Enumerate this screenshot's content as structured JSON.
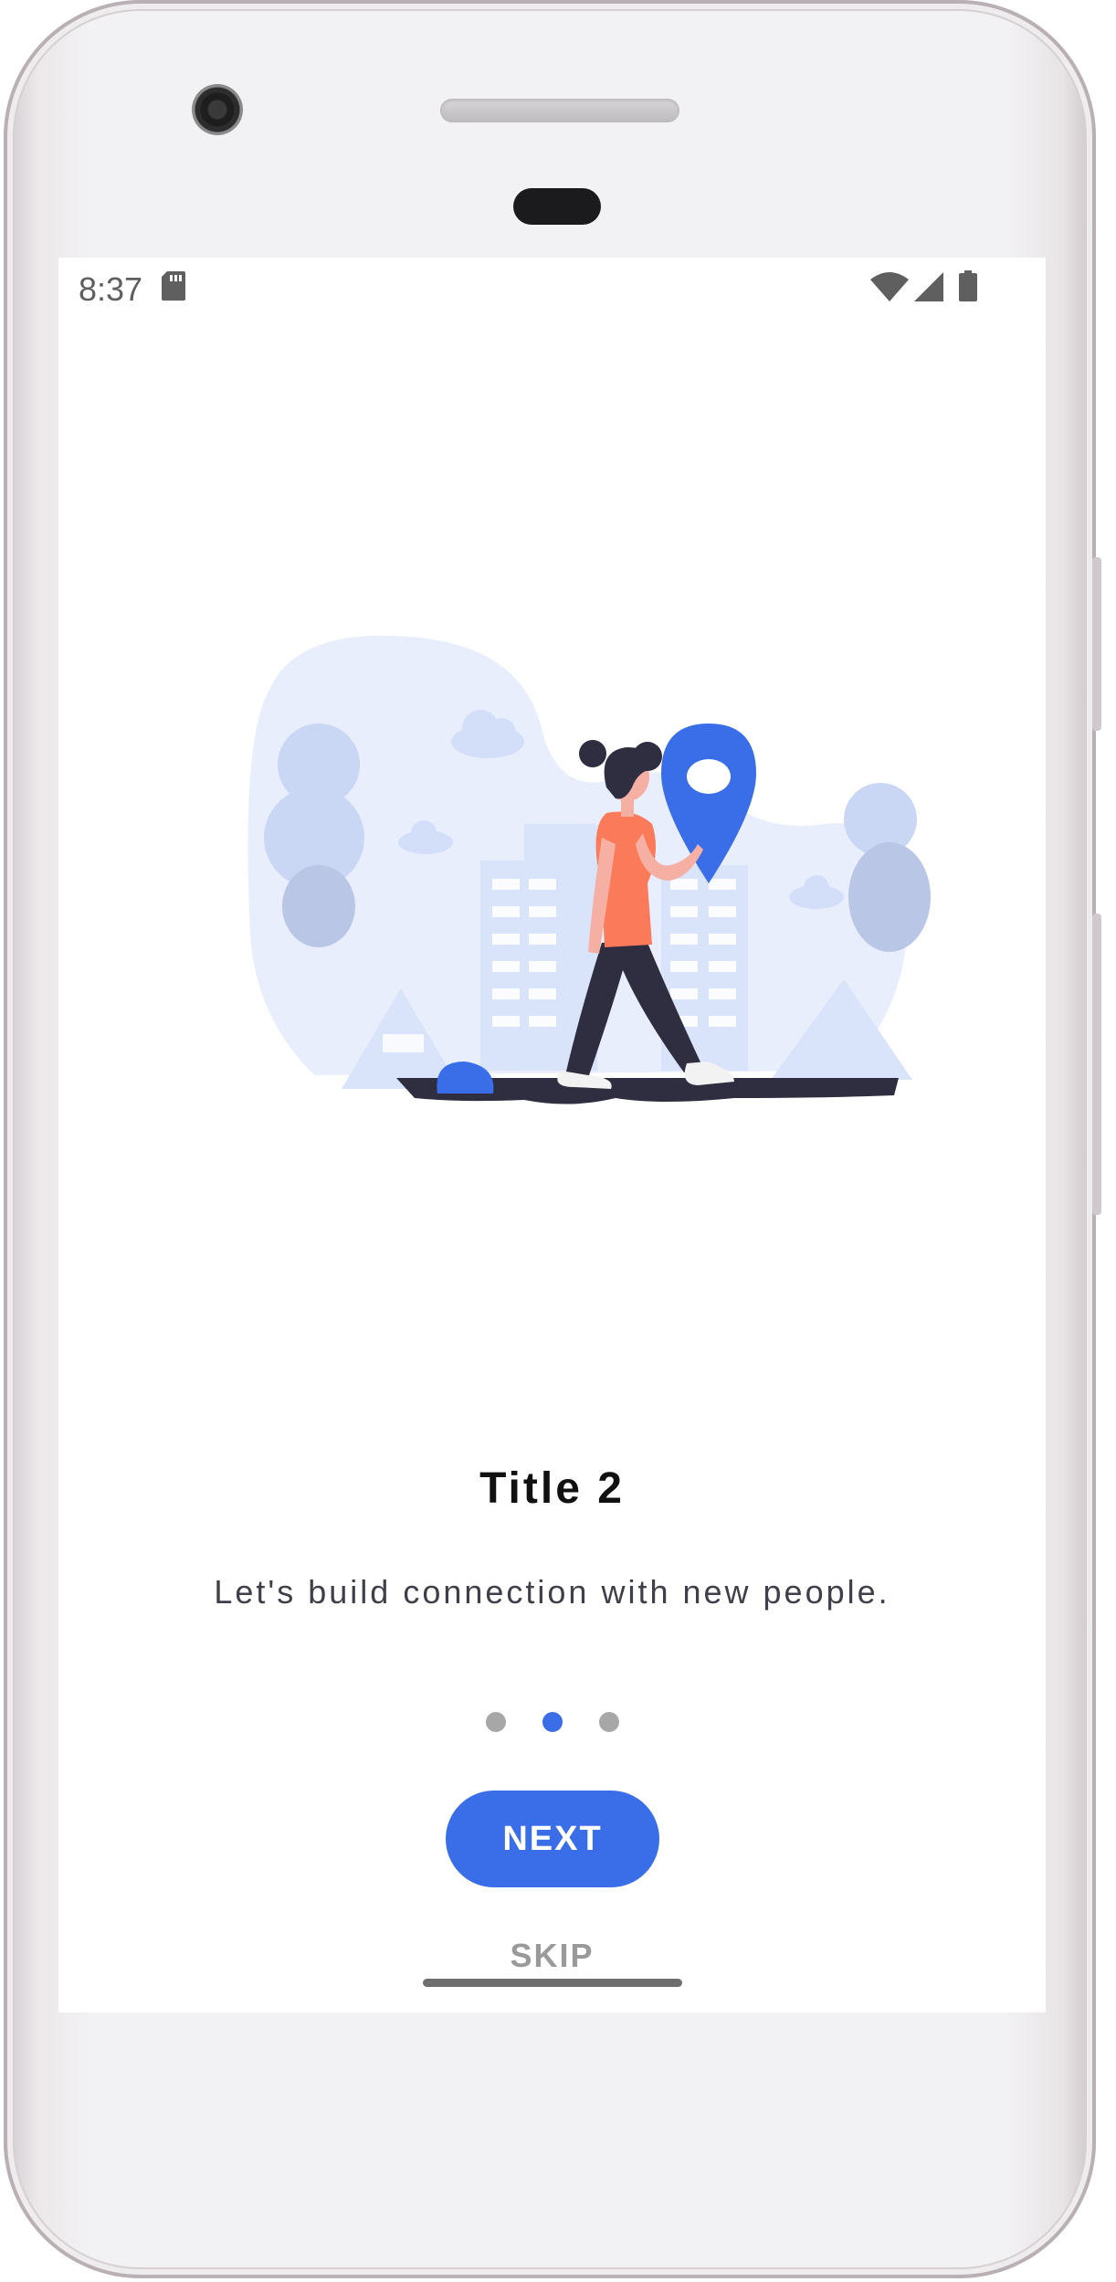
{
  "status_bar": {
    "time": "8:37",
    "icons": [
      "sd-card-icon",
      "wifi-icon",
      "signal-icon",
      "battery-icon"
    ]
  },
  "onboarding": {
    "title": "Title 2",
    "subtitle": "Let's build connection with new people.",
    "page_count": 3,
    "active_page": 2,
    "next_label": "NEXT",
    "skip_label": "SKIP"
  },
  "colors": {
    "accent": "#3a6ee8",
    "shirt": "#fa7a5a",
    "illustration_bg": "#e8eefc",
    "inactive_dot": "#a7a7a7"
  }
}
